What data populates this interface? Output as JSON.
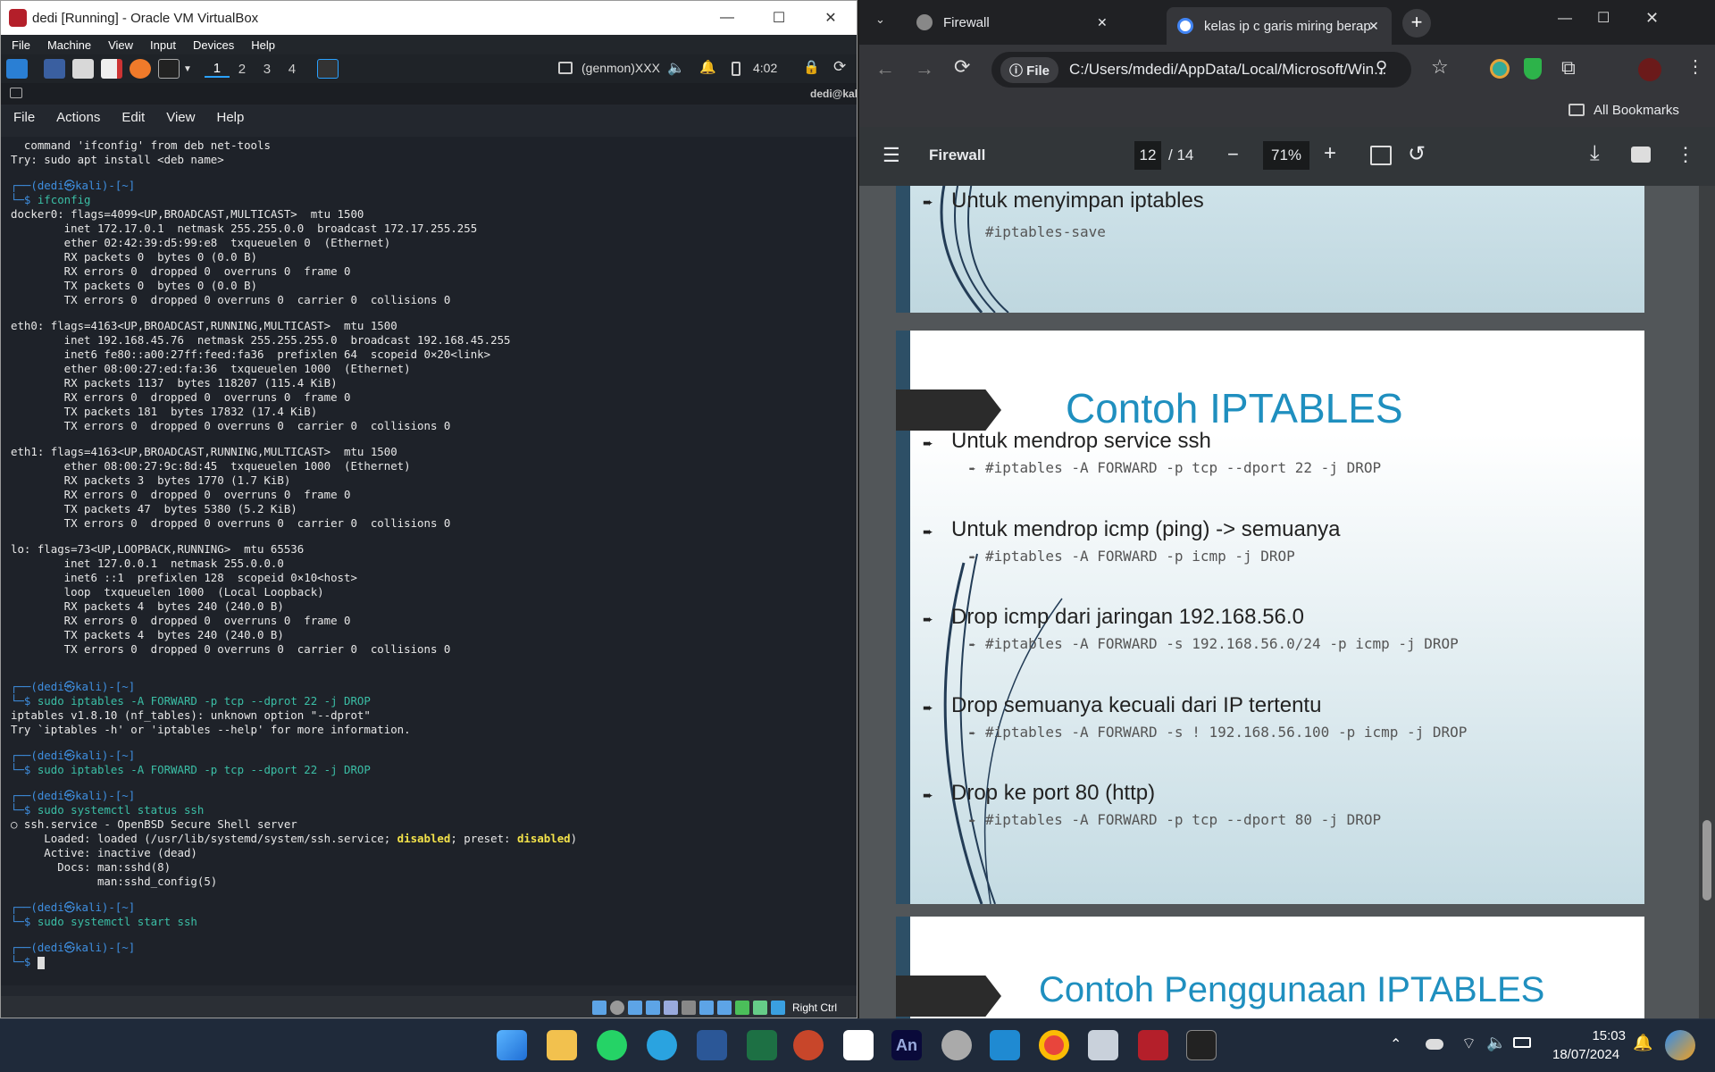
{
  "vbox": {
    "title": "dedi [Running] - Oracle VM VirtualBox",
    "menu": [
      "File",
      "Machine",
      "View",
      "Input",
      "Devices",
      "Help"
    ],
    "panel": {
      "workspaces": [
        "1",
        "2",
        "3",
        "4"
      ],
      "genmon": "(genmon)XXX",
      "clock": "4:02"
    },
    "terminal_tab": "dedi@kal",
    "terminal_menu": [
      "File",
      "Actions",
      "Edit",
      "View",
      "Help"
    ],
    "host_key": "Right Ctrl"
  },
  "terminal_lines": [
    {
      "t": "  command 'ifconfig' from deb net-tools"
    },
    {
      "t": "Try: sudo apt install <deb name>"
    },
    {
      "t": ""
    },
    {
      "t": "┌──(dedi㉿kali)-[~]",
      "c": "p-blue"
    },
    {
      "t": "└─$ ",
      "c": "p-blue",
      "cmd": "ifconfig"
    },
    {
      "t": "docker0: flags=4099<UP,BROADCAST,MULTICAST>  mtu 1500"
    },
    {
      "t": "        inet 172.17.0.1  netmask 255.255.0.0  broadcast 172.17.255.255"
    },
    {
      "t": "        ether 02:42:39:d5:99:e8  txqueuelen 0  (Ethernet)"
    },
    {
      "t": "        RX packets 0  bytes 0 (0.0 B)"
    },
    {
      "t": "        RX errors 0  dropped 0  overruns 0  frame 0"
    },
    {
      "t": "        TX packets 0  bytes 0 (0.0 B)"
    },
    {
      "t": "        TX errors 0  dropped 0 overruns 0  carrier 0  collisions 0"
    },
    {
      "t": ""
    },
    {
      "t": "eth0: flags=4163<UP,BROADCAST,RUNNING,MULTICAST>  mtu 1500"
    },
    {
      "t": "        inet 192.168.45.76  netmask 255.255.255.0  broadcast 192.168.45.255"
    },
    {
      "t": "        inet6 fe80::a00:27ff:feed:fa36  prefixlen 64  scopeid 0×20<link>"
    },
    {
      "t": "        ether 08:00:27:ed:fa:36  txqueuelen 1000  (Ethernet)"
    },
    {
      "t": "        RX packets 1137  bytes 118207 (115.4 KiB)"
    },
    {
      "t": "        RX errors 0  dropped 0  overruns 0  frame 0"
    },
    {
      "t": "        TX packets 181  bytes 17832 (17.4 KiB)"
    },
    {
      "t": "        TX errors 0  dropped 0 overruns 0  carrier 0  collisions 0"
    },
    {
      "t": ""
    },
    {
      "t": "eth1: flags=4163<UP,BROADCAST,RUNNING,MULTICAST>  mtu 1500"
    },
    {
      "t": "        ether 08:00:27:9c:8d:45  txqueuelen 1000  (Ethernet)"
    },
    {
      "t": "        RX packets 3  bytes 1770 (1.7 KiB)"
    },
    {
      "t": "        RX errors 0  dropped 0  overruns 0  frame 0"
    },
    {
      "t": "        TX packets 47  bytes 5380 (5.2 KiB)"
    },
    {
      "t": "        TX errors 0  dropped 0 overruns 0  carrier 0  collisions 0"
    },
    {
      "t": ""
    },
    {
      "t": "lo: flags=73<UP,LOOPBACK,RUNNING>  mtu 65536"
    },
    {
      "t": "        inet 127.0.0.1  netmask 255.0.0.0"
    },
    {
      "t": "        inet6 ::1  prefixlen 128  scopeid 0×10<host>"
    },
    {
      "t": "        loop  txqueuelen 1000  (Local Loopback)"
    },
    {
      "t": "        RX packets 4  bytes 240 (240.0 B)"
    },
    {
      "t": "        RX errors 0  dropped 0  overruns 0  frame 0"
    },
    {
      "t": "        TX packets 4  bytes 240 (240.0 B)"
    },
    {
      "t": "        TX errors 0  dropped 0 overruns 0  carrier 0  collisions 0"
    },
    {
      "t": ""
    },
    {
      "t": ""
    },
    {
      "t": "┌──(dedi㉿kali)-[~]",
      "c": "p-blue"
    },
    {
      "t": "└─$ ",
      "c": "p-blue",
      "cmd": "sudo iptables -A FORWARD -p tcp --dprot 22 -j DROP"
    },
    {
      "t": "iptables v1.8.10 (nf_tables): unknown option \"--dprot\""
    },
    {
      "t": "Try `iptables -h' or 'iptables --help' for more information."
    },
    {
      "t": ""
    },
    {
      "t": "┌──(dedi㉿kali)-[~]",
      "c": "p-blue"
    },
    {
      "t": "└─$ ",
      "c": "p-blue",
      "cmd": "sudo iptables -A FORWARD -p tcp --dport 22 -j DROP"
    },
    {
      "t": ""
    },
    {
      "t": "┌──(dedi㉿kali)-[~]",
      "c": "p-blue"
    },
    {
      "t": "└─$ ",
      "c": "p-blue",
      "cmd": "sudo systemctl status ssh"
    },
    {
      "t": "○ ssh.service - OpenBSD Secure Shell server"
    },
    {
      "t": "     Loaded: loaded (/usr/lib/systemd/system/ssh.service; ",
      "w1": "disabled",
      "m": "; preset: ",
      "w2": "disabled",
      "e": ")"
    },
    {
      "t": "     Active: inactive (dead)"
    },
    {
      "t": "       Docs: man:sshd(8)"
    },
    {
      "t": "             man:sshd_config(5)"
    },
    {
      "t": ""
    },
    {
      "t": "┌──(dedi㉿kali)-[~]",
      "c": "p-blue"
    },
    {
      "t": "└─$ ",
      "c": "p-blue",
      "cmd": "sudo systemctl start ssh"
    },
    {
      "t": ""
    },
    {
      "t": "┌──(dedi㉿kali)-[~]",
      "c": "p-blue"
    },
    {
      "t": "└─$ ",
      "c": "p-blue",
      "cmd": "",
      "cursor": true
    }
  ],
  "chrome": {
    "tabs": [
      {
        "title": "Firewall"
      },
      {
        "title": "kelas ip c garis miring berapa -"
      }
    ],
    "address": "C:/Users/mdedi/AppData/Local/Microsoft/Win...",
    "address_chip": "File",
    "bookmarks_label": "All Bookmarks"
  },
  "pdf": {
    "title": "Firewall",
    "page": "12",
    "total": "/ 14",
    "zoom": "71%",
    "slide_prev": {
      "bullet": "Untuk menyimpan iptables",
      "sub": "#iptables-save"
    },
    "slide_main": {
      "heading": "Contoh IPTABLES",
      "items": [
        {
          "bullet": "Untuk mendrop service ssh",
          "sub": "#iptables -A FORWARD -p tcp --dport 22 -j DROP"
        },
        {
          "bullet": "Untuk mendrop icmp (ping) -> semuanya",
          "sub": "#iptables -A FORWARD -p icmp -j DROP"
        },
        {
          "bullet": "Drop icmp dari jaringan 192.168.56.0",
          "sub": "#iptables -A FORWARD -s 192.168.56.0/24 -p icmp -j DROP"
        },
        {
          "bullet": "Drop semuanya kecuali dari IP tertentu",
          "sub": "#iptables -A FORWARD -s ! 192.168.56.100 -p icmp -j DROP"
        },
        {
          "bullet": "Drop ke port 80 (http)",
          "sub": "#iptables -A FORWARD -p tcp --dport 80 -j DROP"
        }
      ]
    },
    "slide_next": {
      "heading": "Contoh Penggunaan IPTABLES"
    }
  },
  "taskbar": {
    "time": "15:03",
    "date": "18/07/2024"
  },
  "colors": {
    "slide_title": "#1f8fbf",
    "kali_prompt": "#3e8edf",
    "accent": "#2aa1ff"
  }
}
